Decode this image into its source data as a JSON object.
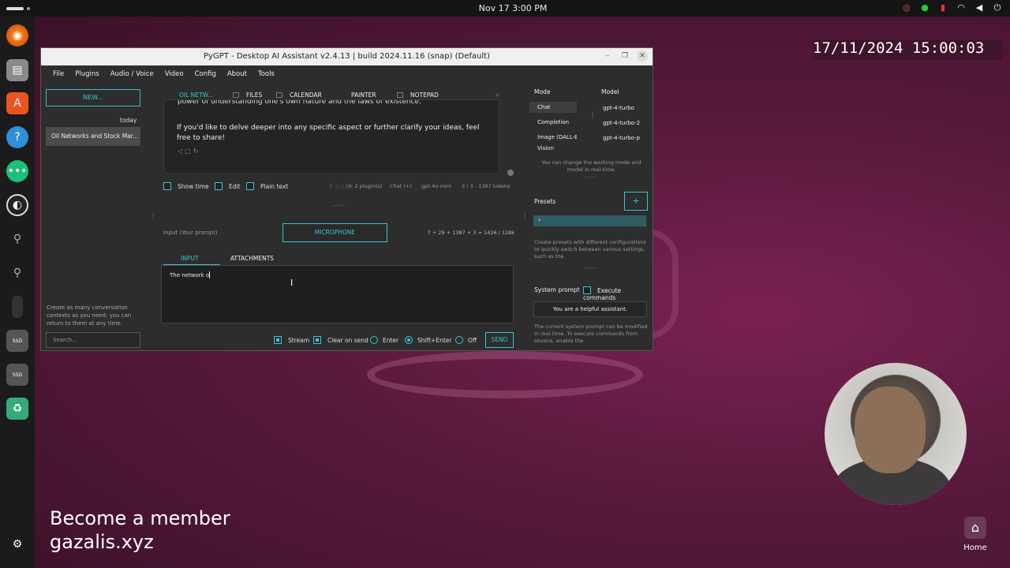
{
  "topbar": {
    "clock": "Nov 17   3:00 PM"
  },
  "overlay": {
    "datetime": "17/11/2024 15:00:03"
  },
  "promo": {
    "line1": "Become a member",
    "line2": "gazalis.xyz"
  },
  "desktop": {
    "home_label": "Home"
  },
  "window": {
    "title": "PyGPT - Desktop AI Assistant v2.4.13 | build 2024.11.16 (snap) (Default)"
  },
  "menu": [
    "File",
    "Plugins",
    "Audio / Voice",
    "Video",
    "Config",
    "About",
    "Tools"
  ],
  "left": {
    "new_label": "NEW...",
    "today_label": "today",
    "conversation": "Oil Networks and Stock Mar...",
    "hint": "Create as many conversation contexts as you need; you can return to them at any time.",
    "search_placeholder": "Search..."
  },
  "tabs": [
    "OIL NETW...",
    "FILES",
    "CALENDAR",
    "PAINTER",
    "NOTEPAD"
  ],
  "chat": {
    "cut_line": "power of understanding one's own nature and the laws of existence.",
    "message": "If you'd like to delve deeper into any specific aspect or further clarify your ideas, feel free to share!"
  },
  "options": {
    "show_time": "Show time",
    "edit": "Edit",
    "plain_text": "Plain text",
    "plugins": "+ 2 plugin(s)",
    "mode": "Chat (+)",
    "model": "gpt-4o-mini",
    "tokens": "3 / 3 - 1387 tokens"
  },
  "input": {
    "label": "Input (Your prompt)",
    "mic_label": "MICROPHONE",
    "token_calc": "7 + 29 + 1387 + 3 = 1426 / 128k",
    "tab_input": "INPUT",
    "tab_attachments": "ATTACHMENTS",
    "text": "The network o"
  },
  "send": {
    "stream": "Stream",
    "clear_on_send": "Clear on send",
    "enter": "Enter",
    "shift_enter": "Shift+Enter",
    "off": "Off",
    "send_label": "SEND"
  },
  "right": {
    "mode_label": "Mode",
    "model_label": "Model",
    "modes": [
      "Chat",
      "Completion",
      "Image (DALL-E",
      "Vision"
    ],
    "models": [
      "gpt-4-turbo",
      "gpt-4-turbo-2",
      "gpt-4-turbo-p"
    ],
    "mode_hint": "You can change the working mode and model in real-time.",
    "presets_label": "Presets",
    "preset_item": "*",
    "preset_hint": "Create presets with different configurations to quickly switch between various settings, such as the",
    "system_prompt_label": "System prompt",
    "execute_commands": "Execute commands",
    "system_prompt": "You are a helpful assistant.",
    "system_hint": "The current system prompt can be modified in real-time. To execute commands from plugins, enable the"
  },
  "colors": {
    "accent": "#39c4d0",
    "window_bg": "#2d2d2d"
  }
}
